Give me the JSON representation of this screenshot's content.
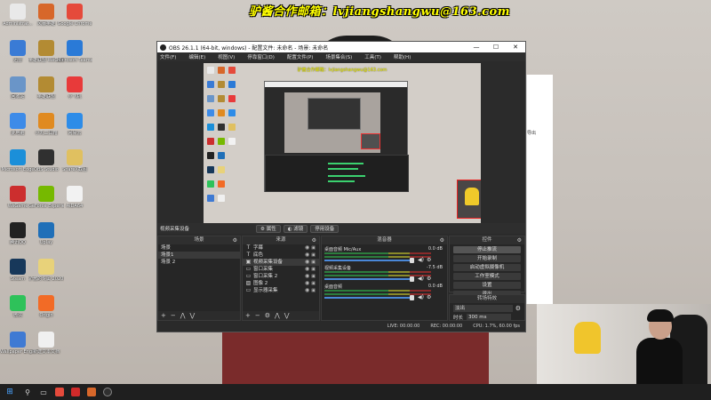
{
  "watermark": "驴酱合作邮箱：lvjiangshangwu@163.com",
  "desktop_icons": [
    {
      "label": "Administrat...",
      "color": "#e9e9e9",
      "col": 0,
      "row": 0
    },
    {
      "label": "迅雷",
      "color": "#3a7bd5",
      "col": 0,
      "row": 1
    },
    {
      "label": "回收站",
      "color": "#6a95c8",
      "col": 0,
      "row": 2
    },
    {
      "label": "此电脑",
      "color": "#3d8be8",
      "col": 0,
      "row": 3
    },
    {
      "label": "Microsoft Edge",
      "color": "#1b8fd9",
      "col": 0,
      "row": 4
    },
    {
      "label": "WeGame",
      "color": "#cc2e2e",
      "col": 0,
      "row": 5
    },
    {
      "label": "腾讯QQ",
      "color": "#222222",
      "col": 0,
      "row": 6
    },
    {
      "label": "Steam",
      "color": "#17385a",
      "col": 0,
      "row": 7
    },
    {
      "label": "微信",
      "color": "#2ec25a",
      "col": 0,
      "row": 8
    },
    {
      "label": "Wallpaper Engine",
      "color": "#3f7ad3",
      "col": 0,
      "row": 9
    },
    {
      "label": "风暴英雄",
      "color": "#d7672a",
      "col": 1,
      "row": 0
    },
    {
      "label": "英雄联盟 WeGame版",
      "color": "#b38b33",
      "col": 1,
      "row": 1
    },
    {
      "label": "英雄联盟",
      "color": "#b38b33",
      "col": 1,
      "row": 2
    },
    {
      "label": "小丸工具箱",
      "color": "#e08a20",
      "col": 1,
      "row": 3
    },
    {
      "label": "OBS Studio",
      "color": "#303030",
      "col": 1,
      "row": 4
    },
    {
      "label": "GeForce Experience",
      "color": "#76b900",
      "col": 1,
      "row": 5
    },
    {
      "label": "Uplay",
      "color": "#1f6fb8",
      "col": 1,
      "row": 6
    },
    {
      "label": "驴酱的专属 2020.2.14",
      "color": "#e8d27a",
      "col": 1,
      "row": 7
    },
    {
      "label": "Origin",
      "color": "#f26b26",
      "col": 1,
      "row": 8
    },
    {
      "label": "新建文本文档",
      "color": "#f0f0f0",
      "col": 1,
      "row": 9
    },
    {
      "label": "Google Chrome",
      "color": "#e54a3b",
      "col": 2,
      "row": 0
    },
    {
      "label": "Microsoft Teams",
      "color": "#2a7ad7",
      "col": 2,
      "row": 1
    },
    {
      "label": "小飞机",
      "color": "#e83a3a",
      "col": 2,
      "row": 2
    },
    {
      "label": "网易云",
      "color": "#2d8ce8",
      "col": 2,
      "row": 3
    },
    {
      "label": "ShareX截图",
      "color": "#e0c060",
      "col": 2,
      "row": 4
    },
    {
      "label": "AIDA64",
      "color": "#f2f2f2",
      "col": 2,
      "row": 5
    }
  ],
  "obs": {
    "title": "OBS 26.1.1 (64-bit, windows) - 配置文件: 未命名 - 场景: 未命名",
    "window_buttons": [
      "—",
      "☐",
      "✕"
    ],
    "menu": [
      "文件(F)",
      "编辑(E)",
      "视图(V)",
      "停靠窗口(D)",
      "配置文件(P)",
      "场景集合(S)",
      "工具(T)",
      "帮助(H)"
    ],
    "preview_caption": "驴酱合作邮箱：lvjiangshangwu@163.com",
    "toolbar": {
      "source_name": "视频采集设备",
      "properties": "属性",
      "filters": "滤镜",
      "deactivate": "停用设备"
    },
    "scenes": {
      "title": "场景",
      "items": [
        "场景",
        "场景1",
        "场景 2"
      ],
      "selected": 1
    },
    "sources": {
      "title": "来源",
      "items": [
        {
          "icon": "T",
          "name": "字幕"
        },
        {
          "icon": "T",
          "name": "底色"
        },
        {
          "icon": "▣",
          "name": "视频采集设备"
        },
        {
          "icon": "▭",
          "name": "窗口采集"
        },
        {
          "icon": "▭",
          "name": "窗口采集 2"
        },
        {
          "icon": "▨",
          "name": "图像 2"
        },
        {
          "icon": "▭",
          "name": "显示器采集"
        }
      ],
      "selected": 2
    },
    "mixer": {
      "title": "混音器",
      "channels": [
        {
          "name": "桌面音频 Mic/Aux",
          "db": "0.0 dB"
        },
        {
          "name": "视频采集设备",
          "db": "-7.5 dB"
        },
        {
          "name": "桌面音频",
          "db": "0.0 dB"
        }
      ]
    },
    "controls": {
      "title": "控件",
      "buttons": [
        "停止推流",
        "开始录制",
        "启动虚拟摄像机",
        "工作室模式",
        "设置",
        "退出"
      ]
    },
    "transitions": {
      "title": "转场特效",
      "selected": "淡出",
      "duration_label": "时长",
      "duration": "300 ms"
    },
    "status": [
      "LIVE: 00:00:00",
      "REC: 00:00:00",
      "CPU: 1.7%, 60.00 fps"
    ]
  },
  "right_window": {
    "text": "导出"
  },
  "taskbar": {
    "start_icon": "windows-logo",
    "apps": [
      "search-icon",
      "task-view-icon",
      "chrome-icon",
      "netease-music-icon",
      "game-icon",
      "obs-icon"
    ]
  }
}
